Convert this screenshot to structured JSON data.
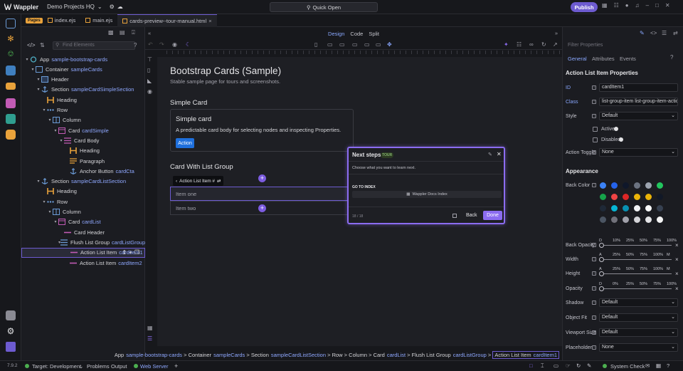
{
  "app": {
    "name": "Wappler",
    "project": "Demo Projects HQ",
    "quick_open": "Quick Open",
    "publish": "Publish"
  },
  "tabs": {
    "pages_tag": "Pages",
    "items": [
      {
        "label": "index.ejs"
      },
      {
        "label": "main.ejs"
      },
      {
        "label": "cards-preview--tour-manual.html"
      }
    ]
  },
  "structure": {
    "find_placeholder": "Find Elements",
    "nodes": [
      {
        "type": "App",
        "id": "sample-bootstrap-cards",
        "icon": "app"
      },
      {
        "type": "Container",
        "id": "sampleCards",
        "icon": "container"
      },
      {
        "type": "Header",
        "id": "",
        "icon": "header"
      },
      {
        "type": "Section",
        "id": "sampleCardSimpleSection",
        "icon": "anchor"
      },
      {
        "type": "Heading",
        "id": "",
        "icon": "heading"
      },
      {
        "type": "Row",
        "id": "",
        "icon": "row"
      },
      {
        "type": "Column",
        "id": "",
        "icon": "column"
      },
      {
        "type": "Card",
        "id": "cardSimple",
        "icon": "card"
      },
      {
        "type": "Card Body",
        "id": "",
        "icon": "cardbody"
      },
      {
        "type": "Heading",
        "id": "",
        "icon": "heading"
      },
      {
        "type": "Paragraph",
        "id": "",
        "icon": "paragraph"
      },
      {
        "type": "Anchor Button",
        "id": "cardCta",
        "icon": "anchor"
      },
      {
        "type": "Section",
        "id": "sampleCardListSection",
        "icon": "anchor"
      },
      {
        "type": "Heading",
        "id": "",
        "icon": "heading"
      },
      {
        "type": "Row",
        "id": "",
        "icon": "row"
      },
      {
        "type": "Column",
        "id": "",
        "icon": "column"
      },
      {
        "type": "Card",
        "id": "cardList",
        "icon": "card"
      },
      {
        "type": "Card Header",
        "id": "",
        "icon": "line"
      },
      {
        "type": "Flush List Group",
        "id": "cardListGroup",
        "icon": "list"
      },
      {
        "type": "Action List Item",
        "id": "cardItem1",
        "icon": "line"
      },
      {
        "type": "Action List Item",
        "id": "cardItem2",
        "icon": "line"
      }
    ]
  },
  "view_modes": {
    "design": "Design",
    "code": "Code",
    "split": "Split"
  },
  "page": {
    "title": "Bootstrap Cards (Sample)",
    "subtitle": "Stable sample page for tours and screenshots.",
    "simple_card_heading": "Simple Card",
    "card_title": "Simple card",
    "card_text": "A predictable card body for selecting nodes and inspecting Properties.",
    "action_label": "Action",
    "list_heading": "Card With List Group",
    "item_badge": "Action List Item #",
    "item_one": "Item one",
    "item_two": "Item two"
  },
  "tour": {
    "title": "Next steps",
    "badge": "TOUR",
    "prompt": "Choose what you want to learn next.",
    "section": "GO TO INDEX",
    "link": "Wappler Docs Index",
    "progress": "18 / 18",
    "back": "Back",
    "done": "Done"
  },
  "breadcrumb": [
    {
      "type": "App",
      "id": "sample-bootstrap-cards"
    },
    {
      "type": "Container",
      "id": "sampleCards"
    },
    {
      "type": "Section",
      "id": "sampleCardListSection"
    },
    {
      "type": "Row",
      "id": ""
    },
    {
      "type": "Column",
      "id": ""
    },
    {
      "type": "Card",
      "id": "cardList"
    },
    {
      "type": "Flush List Group",
      "id": "cardListGroup"
    },
    {
      "type": "Action List Item",
      "id": "cardItem1"
    }
  ],
  "properties": {
    "filter_placeholder": "Filter Properties",
    "tabs": [
      "General",
      "Attributes",
      "Events"
    ],
    "heading": "Action List Item Properties",
    "id_label": "ID",
    "id_value": "cardItem1",
    "class_label": "Class",
    "class_value": "list-group-item list-group-item-action",
    "style_label": "Style",
    "style_value": "Default",
    "active_label": "Active",
    "disabled_label": "Disabled",
    "toggle_label": "Action Toggle",
    "toggle_value": "None",
    "appearance": "Appearance",
    "back_color": "Back Color",
    "back_opacity": "Back Opacity",
    "width": "Width",
    "height": "Height",
    "opacity": "Opacity",
    "shadow": "Shadow",
    "shadow_value": "Default",
    "object_fit": "Object Fit",
    "object_fit_value": "Default",
    "viewport_size": "Viewport Size",
    "viewport_value": "Default",
    "placeholder": "Placeholder",
    "placeholder_value": "None",
    "pct_scale": [
      "0",
      "10%",
      "25%",
      "50%",
      "75%",
      "100%"
    ],
    "size_scale": [
      "A",
      "25%",
      "50%",
      "75%",
      "100%",
      "M"
    ],
    "back_opacity_scale": [
      "D",
      "10%",
      "25%",
      "50%",
      "75%",
      "100%"
    ],
    "opacity_scale": [
      "D",
      "0%",
      "25%",
      "50%",
      "75%",
      "100%"
    ],
    "swatch_colors": [
      "#3b82f6",
      "#2563eb",
      "#0f172a",
      "#6b7280",
      "#9ca3af",
      "#22c55e",
      "#16a34a",
      "#ef4444",
      "#dc2626",
      "#eab308",
      "#eab308",
      "#111827",
      "#1f2937",
      "#06b6d4",
      "#0891b2",
      "#f3f4f6",
      "#f9fafb",
      "#374151",
      "#4b5563",
      "#71717a",
      "#a1a1aa",
      "#d4d4d8",
      "#e4e4e7",
      "#f4f4f5"
    ]
  },
  "status": {
    "version": "7.9.2",
    "target": "Target: Development",
    "problems": "Problems",
    "output": "Output",
    "web_server": "Web Server",
    "system_check": "System Check"
  },
  "colors": {
    "accent": "#6d5bd0",
    "link": "#8fa8ff",
    "primary_btn": "#1e6fdc"
  }
}
